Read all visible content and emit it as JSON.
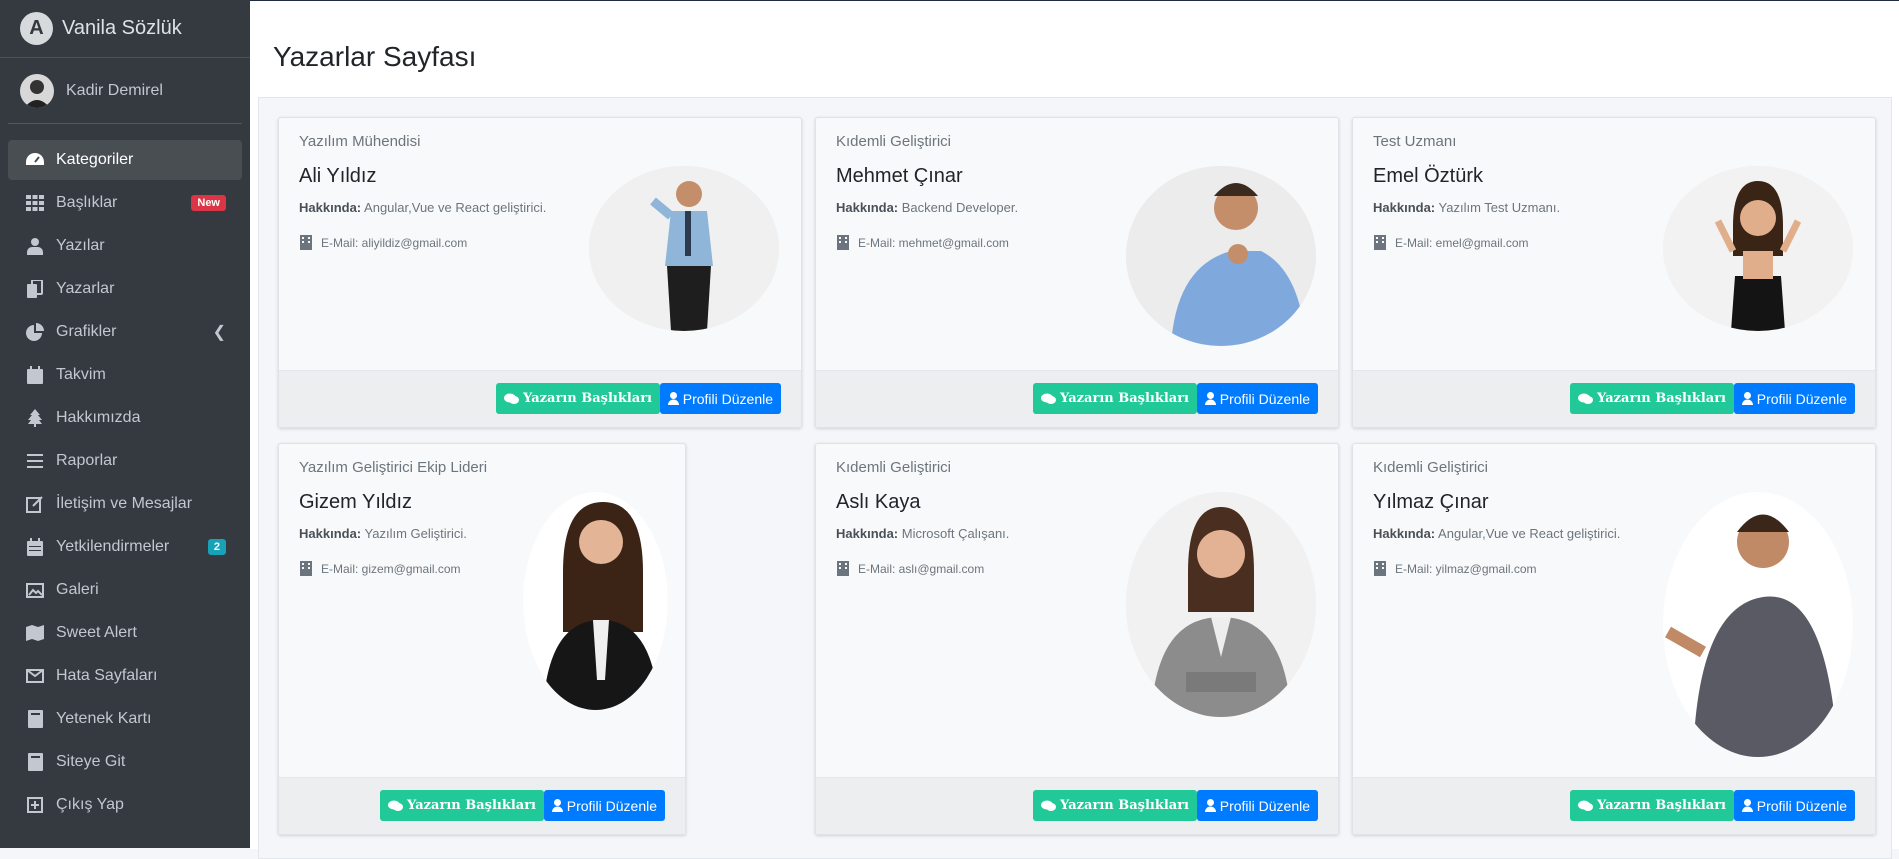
{
  "sidebar": {
    "brand": "Vanila Sözlük",
    "user": "Kadir Demirel",
    "items": [
      {
        "label": "Kategoriler",
        "icon": "tachometer-icon"
      },
      {
        "label": "Başlıklar",
        "icon": "grid-icon",
        "badge": "New"
      },
      {
        "label": "Yazılar",
        "icon": "user-tie-icon"
      },
      {
        "label": "Yazarlar",
        "icon": "copy-icon"
      },
      {
        "label": "Grafikler",
        "icon": "pie-chart-icon"
      },
      {
        "label": "Takvim",
        "icon": "calendar-icon"
      },
      {
        "label": "Hakkımızda",
        "icon": "tree-icon"
      },
      {
        "label": "Raporlar",
        "icon": "bars-icon"
      },
      {
        "label": "İletişim ve Mesajlar",
        "icon": "edit-icon"
      },
      {
        "label": "Yetkilendirmeler",
        "icon": "calendar-grid-icon",
        "badge": "2"
      },
      {
        "label": "Galeri",
        "icon": "image-icon"
      },
      {
        "label": "Sweet Alert",
        "icon": "map-icon"
      },
      {
        "label": "Hata Sayfaları",
        "icon": "envelope-icon"
      },
      {
        "label": "Yetenek Kartı",
        "icon": "book-icon"
      },
      {
        "label": "Siteye Git",
        "icon": "book-icon"
      },
      {
        "label": "Çıkış Yap",
        "icon": "plus-square-icon"
      }
    ]
  },
  "page": {
    "title": "Yazarlar Sayfası"
  },
  "cards": [
    {
      "role": "Yazılım Mühendisi",
      "name": "Ali Yıldız",
      "about_label": "Hakkında:",
      "about": "Angular,Vue ve React geliştirici.",
      "mail": "E-Mail: aliyildiz@gmail.com",
      "btn1": "Yazarın Başlıkları",
      "btn2": "Profili Düzenle"
    },
    {
      "role": "Kıdemli Geliştirici",
      "name": "Mehmet Çınar",
      "about_label": "Hakkında:",
      "about": "Backend Developer.",
      "mail": "E-Mail: mehmet@gmail.com",
      "btn1": "Yazarın Başlıkları",
      "btn2": "Profili Düzenle"
    },
    {
      "role": "Test Uzmanı",
      "name": "Emel Öztürk",
      "about_label": "Hakkında:",
      "about": "Yazılım Test Uzmanı.",
      "mail": "E-Mail: emel@gmail.com",
      "btn1": "Yazarın Başlıkları",
      "btn2": "Profili Düzenle"
    },
    {
      "role": "Yazılım Geliştirici Ekip Lideri",
      "name": "Gizem Yıldız",
      "about_label": "Hakkında:",
      "about": "Yazılım Geliştirici.",
      "mail": "E-Mail: gizem@gmail.com",
      "btn1": "Yazarın Başlıkları",
      "btn2": "Profili Düzenle"
    },
    {
      "role": "Kıdemli Geliştirici",
      "name": "Aslı Kaya",
      "about_label": "Hakkında:",
      "about": "Microsoft Çalışanı.",
      "mail": "E-Mail: aslı@gmail.com",
      "btn1": "Yazarın Başlıkları",
      "btn2": "Profili Düzenle"
    },
    {
      "role": "Kıdemli Geliştirici",
      "name": "Yılmaz Çınar",
      "about_label": "Hakkında:",
      "about": "Angular,Vue ve React geliştirici.",
      "mail": "E-Mail: yilmaz@gmail.com",
      "btn1": "Yazarın Başlıkları",
      "btn2": "Profili Düzenle"
    }
  ],
  "colors": {
    "sidebar": "#343a40",
    "green": "#20c997",
    "blue": "#007bff",
    "badge_red": "#dc3545",
    "badge_teal": "#17a2b8"
  }
}
